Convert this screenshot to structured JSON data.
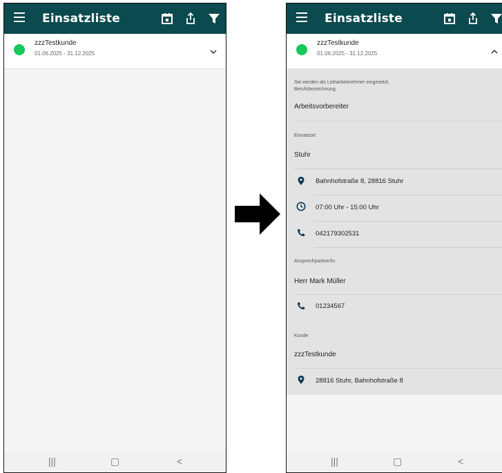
{
  "app": {
    "title": "Einsatzliste"
  },
  "entry": {
    "customer": "zzzTestkunde",
    "dates": "01.06.2025 - 31.12.2025",
    "status_color": "#18c75a"
  },
  "details": {
    "note_line1": "Sie werden als Leiharbeitnehmer eingesetzt.",
    "job_label": "Berufsbezeichnung",
    "job_value": "Arbeitsvorbereiter",
    "location_label": "Einsatzort",
    "location_value": "Stuhr",
    "address": "Bahnhofstraße 8, 28816 Stuhr",
    "hours": "07:00 Uhr - 15:00 Uhr",
    "phone": "042179302531",
    "contact_label": "Ansprechpartner/in",
    "contact_value": "Herr Mark Müller",
    "contact_phone": "01234567",
    "customer_label": "Kunde",
    "customer_value": "zzzTestkunde",
    "customer_address": "28816 Stuhr, Bahnhofstraße 8"
  },
  "navbar": {
    "recent": "|||",
    "home": "▢",
    "back": "<"
  },
  "colors": {
    "appbar": "#0b4a4e",
    "icon": "#0b3a56"
  }
}
